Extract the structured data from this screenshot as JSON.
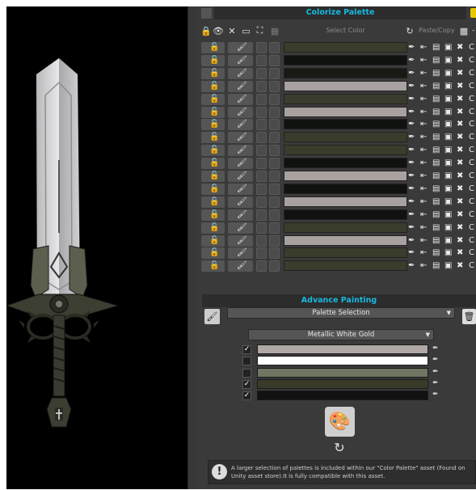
{
  "header": {
    "title": "Colorize Palette"
  },
  "toolbar": {
    "select_color_label": "Select Color",
    "paste_copy_label": "Paste/Copy"
  },
  "palette_rows": [
    {
      "color": "#3a3c2c"
    },
    {
      "color": "#101210"
    },
    {
      "color": "#181a14"
    },
    {
      "color": "#a9a0a0"
    },
    {
      "color": "#3a3c2c"
    },
    {
      "color": "#a9a0a0"
    },
    {
      "color": "#101210"
    },
    {
      "color": "#3a3c2c"
    },
    {
      "color": "#3a3c2c"
    },
    {
      "color": "#101210"
    },
    {
      "color": "#a9a0a0"
    },
    {
      "color": "#101210"
    },
    {
      "color": "#a9a0a0"
    },
    {
      "color": "#101210"
    },
    {
      "color": "#3a3c2c"
    },
    {
      "color": "#a9a0a0"
    },
    {
      "color": "#3a3c2c"
    },
    {
      "color": "#3a3c2c"
    }
  ],
  "advance": {
    "title": "Advance Painting",
    "palette_selection_label": "Palette Selection",
    "palette_name": "Metallic White Gold"
  },
  "palette_colors": [
    {
      "color": "#b0a8a4",
      "checked": true
    },
    {
      "color": "#ffffff",
      "checked": false
    },
    {
      "color": "#6e7560",
      "checked": false
    },
    {
      "color": "#3a3a28",
      "checked": true
    },
    {
      "color": "#111111",
      "checked": true
    }
  ],
  "info_text": "A larger selection of palettes is included within our \"Color Palette\" asset (Found on Unity asset store).It is fully compatible with this asset.",
  "icons": {
    "lock": "lock-icon",
    "eye": "eye-icon",
    "close": "close-icon",
    "brush": "brush-icon",
    "eyedropper": "eyedropper-icon",
    "refresh": "refresh-icon",
    "info": "info-icon"
  }
}
